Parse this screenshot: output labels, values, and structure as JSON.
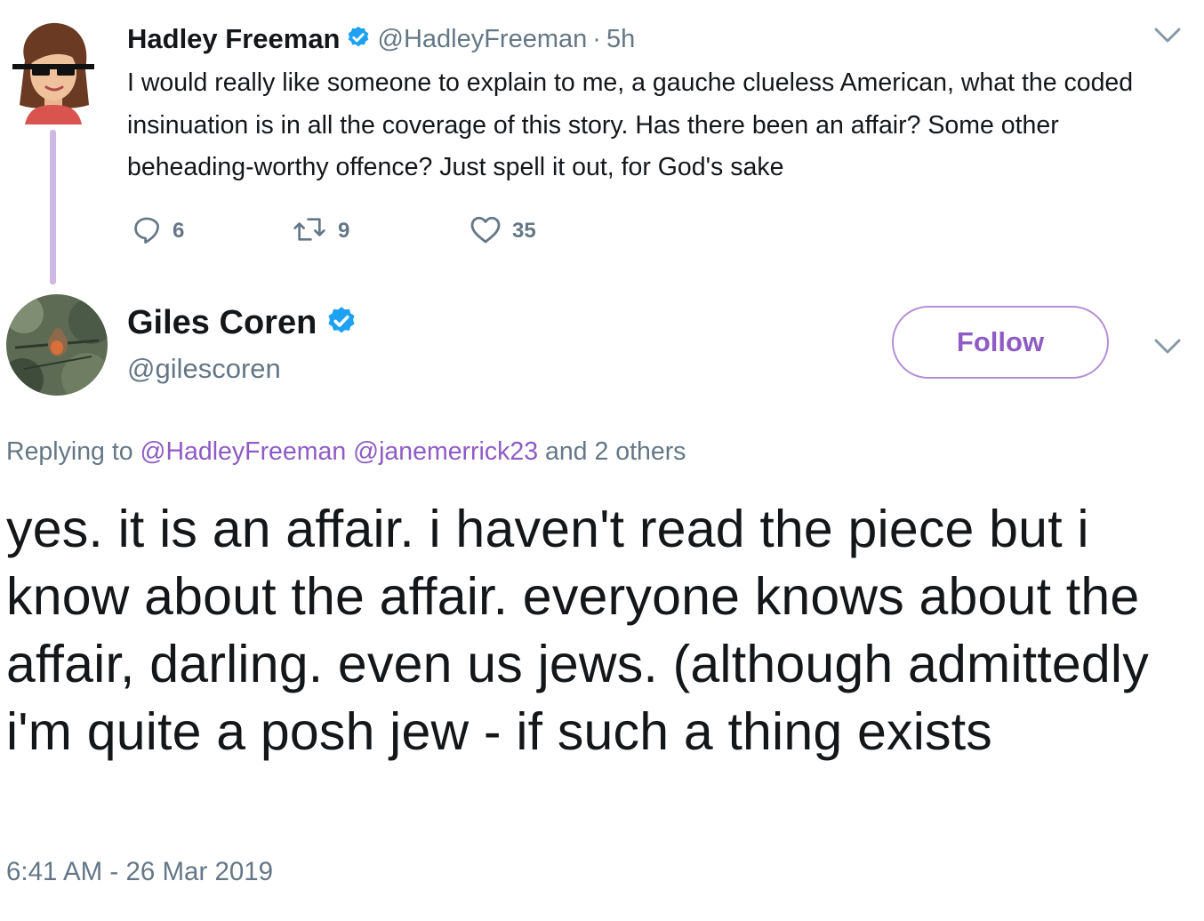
{
  "tweet1": {
    "name": "Hadley Freeman",
    "handle": "@HadleyFreeman",
    "separator": "·",
    "time": "5h",
    "body": "I would really like someone to explain to me, a gauche clueless American, what the coded insinuation is in all the coverage of this story. Has there been an affair? Some other beheading-worthy offence? Just spell it out, for God's sake",
    "replies": "6",
    "retweets": "9",
    "likes": "35",
    "icons": {
      "reply": "reply-icon",
      "retweet": "retweet-icon",
      "like": "heart-icon",
      "menu": "chevron-down-icon",
      "verified": "verified-badge-icon"
    }
  },
  "tweet2": {
    "name": "Giles Coren",
    "handle": "@gilescoren",
    "follow_label": "Follow",
    "replying_prefix": "Replying to",
    "replying_mention1": "@HadleyFreeman",
    "replying_mention2": "@janemerrick23",
    "replying_suffix": "and 2 others",
    "body": "yes. it is an affair. i haven't read the piece but i know about the affair. everyone knows about the affair, darling. even us jews. (although admittedly i'm quite a posh jew - if such a thing exists",
    "timestamp": "6:41 AM - 26 Mar 2019"
  },
  "colors": {
    "accent": "#8e5cc4",
    "verified": "#1da1f2",
    "muted": "#657786",
    "text": "#14171a",
    "thread_line": "#cdb8e6"
  }
}
